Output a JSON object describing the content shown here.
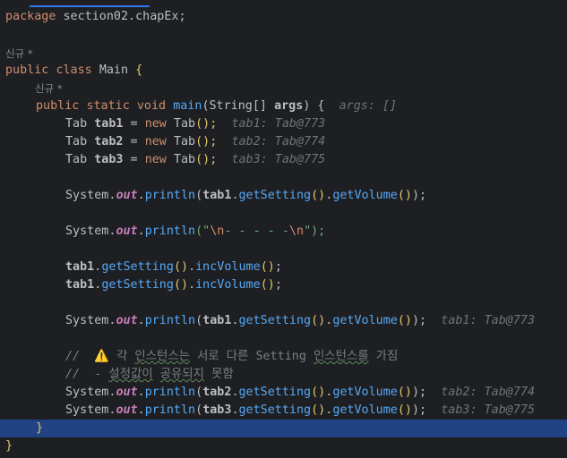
{
  "editor": {
    "package_kw": "package",
    "package_name": "section02.chapEx;",
    "author_hint_1": "신규 *",
    "class_public": "public",
    "class_kw": "class",
    "class_name": "Main",
    "open_brace": "{",
    "author_hint_2": "신규 *",
    "main_sig": {
      "public": "public",
      "static": "static",
      "void": "void",
      "name": "main",
      "param_type": "(String[]",
      "param_name": "args",
      "tail": ") {",
      "hint": "args: []"
    },
    "tab_decls": [
      {
        "type": "Tab",
        "var": "tab1",
        "op": " = ",
        "new": "new",
        "ctor": "Tab",
        "tail": "();",
        "hint": "tab1: Tab@773"
      },
      {
        "type": "Tab",
        "var": "tab2",
        "op": " = ",
        "new": "new",
        "ctor": "Tab",
        "tail": "();",
        "hint": "tab2: Tab@774"
      },
      {
        "type": "Tab",
        "var": "tab3",
        "op": " = ",
        "new": "new",
        "ctor": "Tab",
        "tail": "();",
        "hint": "tab3: Tab@775"
      }
    ],
    "sys": "System.",
    "out": "out",
    "println": "println",
    "get_setting": "getSetting",
    "get_volume": "getVolume",
    "inc_volume": "incVolume",
    "string_open": "(\"",
    "string_esc1": "\\n",
    "string_mid": "- - - - -",
    "string_esc2": "\\n",
    "string_close": "\");",
    "hint_tab1": "tab1: Tab@773",
    "hint_tab2": "tab2: Tab@774",
    "hint_tab3": "tab3: Tab@775",
    "comment_1_prefix": "//",
    "comment_1_icon": "⚠️",
    "comment_1_a": "각 ",
    "comment_1_b": "인스턴스는",
    "comment_1_c": " 서로 다른 Setting ",
    "comment_1_d": "인스턴스를",
    "comment_1_e": " 가짐",
    "comment_2_prefix": "//",
    "comment_2_a": "- ",
    "comment_2_b": "설정값이",
    "comment_2_c": " ",
    "comment_2_d": "공유되지",
    "comment_2_e": " 못함",
    "close_method": "}",
    "close_class": "}"
  }
}
